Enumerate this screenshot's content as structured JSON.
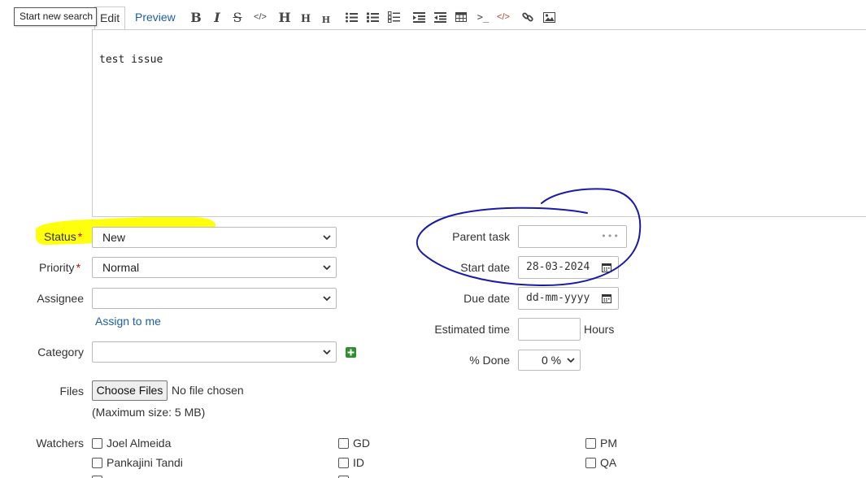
{
  "tooltip": "Start new search",
  "editor_tabs": {
    "edit": "Edit",
    "preview": "Preview"
  },
  "toolbar": [
    {
      "name": "bold-icon",
      "glyph": "B"
    },
    {
      "name": "italic-icon",
      "glyph": "I"
    },
    {
      "name": "strikethrough-icon",
      "glyph": "S"
    },
    {
      "name": "inline-code-icon",
      "glyph": "</>"
    },
    {
      "name": "heading-1-icon",
      "glyph": "H"
    },
    {
      "name": "heading-2-icon",
      "glyph": "H"
    },
    {
      "name": "heading-3-icon",
      "glyph": "H"
    },
    {
      "name": "bullet-list-icon"
    },
    {
      "name": "numbered-list-icon"
    },
    {
      "name": "task-list-icon"
    },
    {
      "name": "indent-icon"
    },
    {
      "name": "outdent-icon"
    },
    {
      "name": "table-icon"
    },
    {
      "name": "pre-icon",
      "glyph": ">_"
    },
    {
      "name": "code-highlight-icon",
      "glyph": "</>"
    },
    {
      "name": "link-icon"
    },
    {
      "name": "image-icon"
    }
  ],
  "description_text": "test issue",
  "fields": {
    "status": {
      "label": "Status",
      "value": "New"
    },
    "priority": {
      "label": "Priority",
      "value": "Normal"
    },
    "assignee": {
      "label": "Assignee",
      "value": ""
    },
    "assign_to_me": "Assign to me",
    "category": {
      "label": "Category",
      "value": ""
    },
    "parent_task": {
      "label": "Parent task",
      "value": "",
      "placeholder": "•••"
    },
    "start_date": {
      "label": "Start date",
      "value": "28-03-2024"
    },
    "due_date": {
      "label": "Due date",
      "value": "dd-mm-yyyy"
    },
    "estimated_time": {
      "label": "Estimated time",
      "value": "",
      "unit": "Hours"
    },
    "done": {
      "label": "% Done",
      "value": "0 %"
    }
  },
  "files": {
    "label": "Files",
    "button": "Choose Files",
    "status": "No file chosen",
    "max_size": "(Maximum size: 5 MB)"
  },
  "watchers": {
    "label": "Watchers",
    "col1": [
      "Joel Almeida",
      "Pankajini Tandi"
    ],
    "col2": [
      "GD",
      "ID"
    ],
    "col3": [
      "PM",
      "QA"
    ]
  },
  "colors": {
    "link": "#1d5fa6",
    "required": "#cc0000",
    "highlight": "#ffff00",
    "annotation": "#1a1aa8"
  }
}
